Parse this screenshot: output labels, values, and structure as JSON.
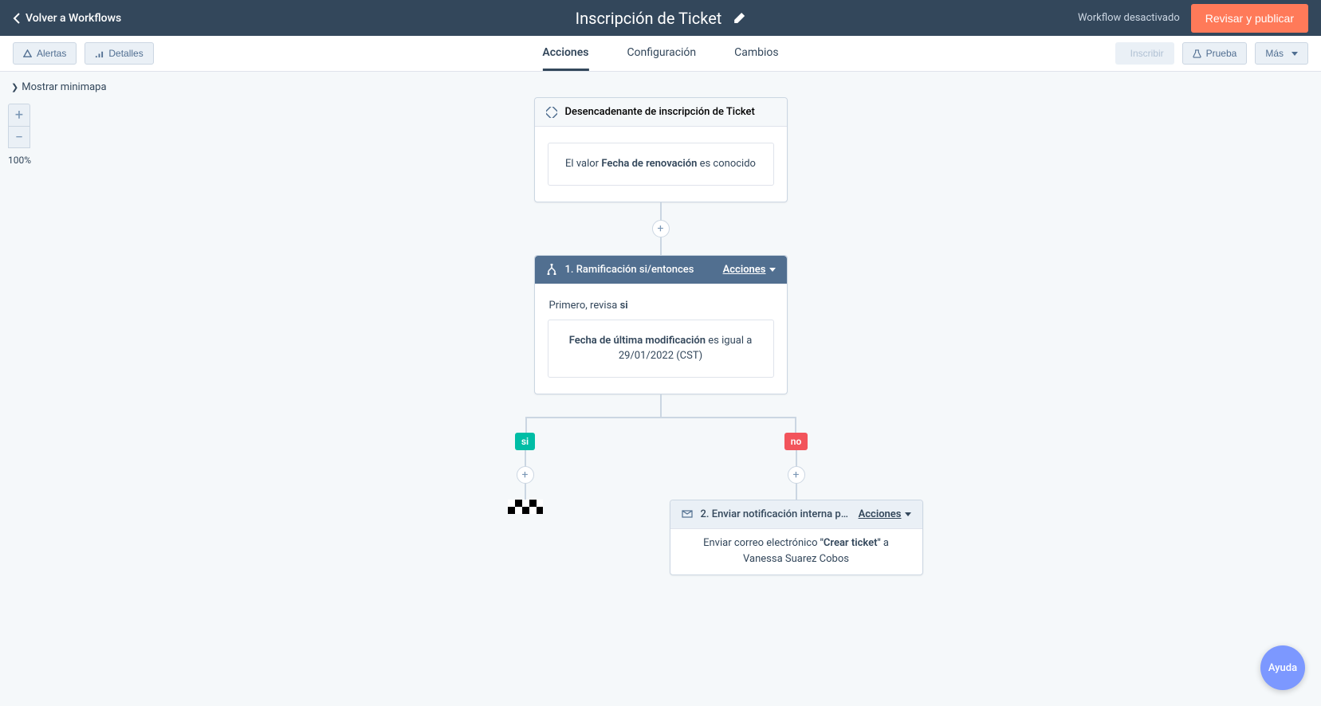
{
  "header": {
    "back": "Volver a Workflows",
    "title": "Inscripción de Ticket",
    "status": "Workflow desactivado",
    "publish": "Revisar y publicar"
  },
  "toolbar": {
    "alerts": "Alertas",
    "details": "Detalles",
    "tabs": {
      "acciones": "Acciones",
      "config": "Configuración",
      "cambios": "Cambios"
    },
    "inscribe": "Inscribir",
    "test": "Prueba",
    "more": "Más"
  },
  "canvas": {
    "minimap": "Mostrar minimapa",
    "zoom": "100%"
  },
  "nodes": {
    "trigger": {
      "title": "Desencadenante de inscripción de Ticket",
      "body_pre": "El valor ",
      "body_bold": "Fecha de renovación",
      "body_post": " es conocido"
    },
    "branch": {
      "title": "1. Ramificación si/entonces",
      "actions": "Acciones",
      "prompt_pre": "Primero, revisa ",
      "prompt_bold": "si",
      "cond_bold": "Fecha de última modificación",
      "cond_post": " es igual a 29/01/2022 (CST)"
    },
    "tags": {
      "si": "si",
      "no": "no"
    },
    "email": {
      "title": "2. Enviar notificación interna po…",
      "actions": "Acciones",
      "body_pre": "Enviar correo electrónico ",
      "body_bold": "\"Crear ticket\"",
      "body_post": " a Vanessa Suarez Cobos"
    }
  },
  "help": "Ayuda"
}
